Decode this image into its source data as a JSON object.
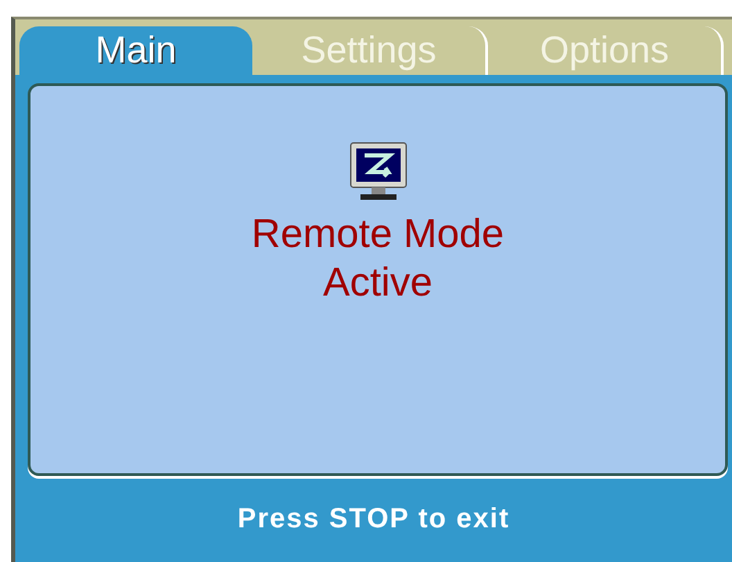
{
  "tabs": [
    {
      "label": "Main",
      "selected": true
    },
    {
      "label": "Settings",
      "selected": false
    },
    {
      "label": "Options",
      "selected": false
    }
  ],
  "status": {
    "lines": [
      "Remote Mode",
      "Active"
    ]
  },
  "footer": "Press STOP to exit"
}
